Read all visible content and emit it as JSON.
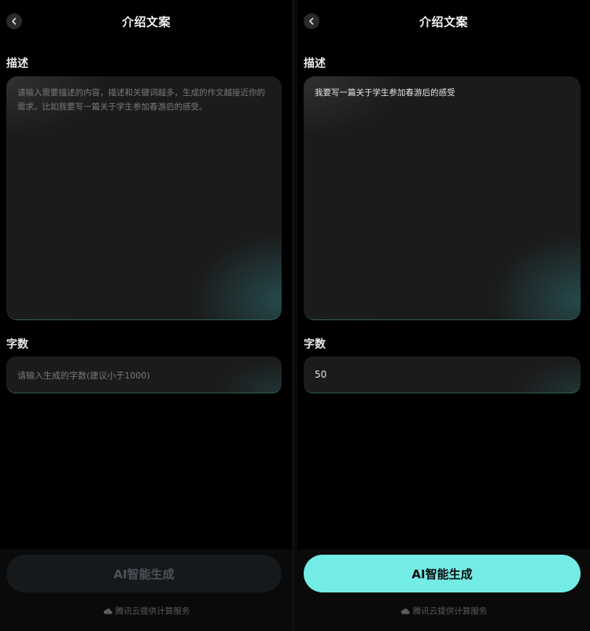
{
  "left_screen": {
    "header": {
      "title": "介绍文案"
    },
    "description": {
      "label": "描述",
      "placeholder": "请输入需要描述的内容，描述和关键词越多，生成的作文越接近你的需求。比如我要写一篇关于学生参加春游后的感受。",
      "value": ""
    },
    "word_count": {
      "label": "字数",
      "placeholder": "请输入生成的字数(建议小于1000)",
      "value": ""
    },
    "generate_button": {
      "label": "AI智能生成",
      "state": "disabled"
    },
    "footer": {
      "text": "腾讯云提供计算服务"
    }
  },
  "right_screen": {
    "header": {
      "title": "介绍文案"
    },
    "description": {
      "label": "描述",
      "value": "我要写一篇关于学生参加春游后的感受"
    },
    "word_count": {
      "label": "字数",
      "value": "50"
    },
    "generate_button": {
      "label": "AI智能生成",
      "state": "enabled"
    },
    "footer": {
      "text": "腾讯云提供计算服务"
    }
  },
  "colors": {
    "background": "#000000",
    "field_background": "#1b1b1b",
    "accent_teal": "#74ece6",
    "disabled_button": "#16191c"
  },
  "icons": {
    "back": "chevron-left-icon",
    "footer": "cloud-icon"
  }
}
